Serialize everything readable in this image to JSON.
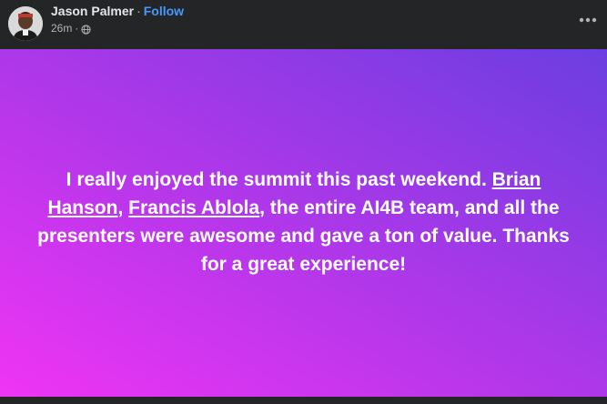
{
  "post": {
    "author": "Jason Palmer",
    "separator": "·",
    "follow_label": "Follow",
    "timestamp": "26m",
    "meta_separator": "·",
    "privacy_icon": "globe-icon",
    "more_icon": "more-options-icon",
    "text_parts": {
      "intro": "I really enjoyed the summit this past weekend. ",
      "mention_1": "Brian Hanson",
      "comma": ", ",
      "mention_2": "Francis Ablola",
      "rest": ", the entire AI4B team, and all the presenters were awesome and gave a ton of value. Thanks for a great experience!"
    },
    "background_colors": {
      "bottom_left": "#f034f4",
      "middle": "#b437ea",
      "top_right": "#6b3ee0"
    },
    "link_color": "#4599ff"
  }
}
